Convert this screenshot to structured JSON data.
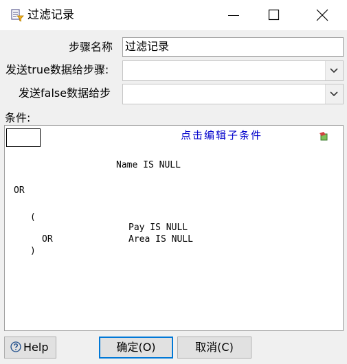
{
  "window": {
    "title": "过滤记录",
    "icon": "filter-document-icon",
    "controls": [
      "minimize-icon",
      "maximize-icon",
      "close-icon"
    ]
  },
  "form": {
    "step_name_label": "步骤名称",
    "step_name_value": "过滤记录",
    "true_target_label": "发送true数据给步骤:",
    "true_target_value": "",
    "false_target_label": "发送false数据给步",
    "false_target_value": ""
  },
  "conditions": {
    "label": "条件:",
    "edit_link": "点击编辑子条件",
    "lines": {
      "name_cond": "Name IS NULL",
      "or_top": "OR",
      "paren_open": "(",
      "pay_cond": "Pay IS NULL",
      "or_inner": "OR",
      "area_cond": "Area IS NULL",
      "paren_close": ")"
    }
  },
  "buttons": {
    "help": "Help",
    "ok": "确定(O)",
    "cancel": "取消(C)"
  },
  "colors": {
    "link": "#0000cc",
    "focus_border": "#0078d7",
    "background": "#f0f0f0"
  }
}
